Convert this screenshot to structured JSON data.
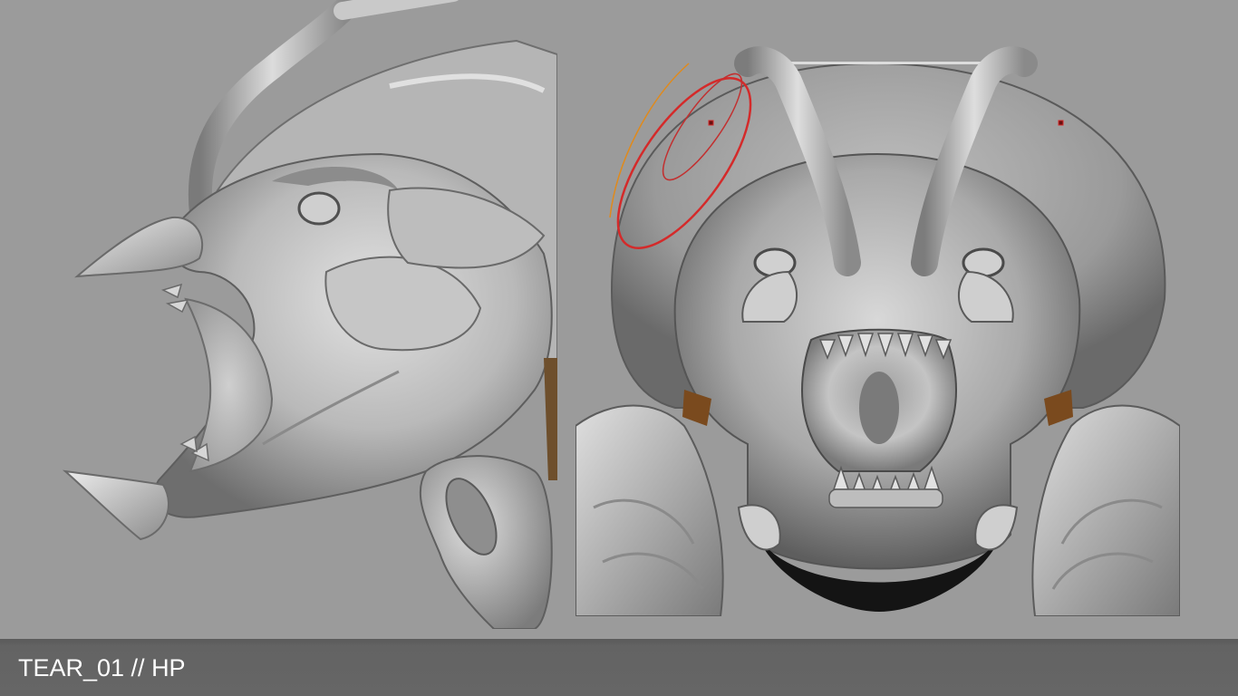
{
  "caption": {
    "text": "TEAR_01 // HP"
  },
  "views": [
    {
      "view": "side"
    },
    {
      "view": "front"
    }
  ],
  "colors": {
    "background": "#9b9b9b",
    "caption_bar": "#666666",
    "caption_text": "#ffffff",
    "clay_light": "#d8d8d8",
    "clay_mid": "#a8a8a8",
    "clay_dark": "#4a4a4a",
    "brush_ring_red": "#d42a2a",
    "brush_ring_orange": "#e08a1c"
  }
}
